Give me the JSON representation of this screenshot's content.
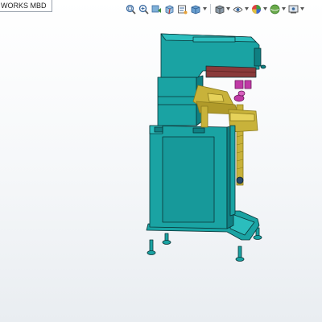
{
  "document": {
    "tab_label": "WORKS MBD"
  },
  "toolbar": {
    "buttons": [
      {
        "name": "zoom-to-fit-icon",
        "dropdown": false
      },
      {
        "name": "zoom-to-area-icon",
        "dropdown": false
      },
      {
        "name": "previous-view-icon",
        "dropdown": false
      },
      {
        "name": "section-view-icon",
        "dropdown": false
      },
      {
        "name": "dynamic-annotation-icon",
        "dropdown": false
      },
      {
        "name": "view-orientation-icon",
        "dropdown": true
      },
      {
        "name": "display-style-icon",
        "dropdown": true
      },
      {
        "name": "hide-show-items-icon",
        "dropdown": true
      },
      {
        "name": "edit-appearance-icon",
        "dropdown": true
      },
      {
        "name": "apply-scene-icon",
        "dropdown": true
      },
      {
        "name": "view-settings-icon",
        "dropdown": true
      }
    ]
  },
  "colors": {
    "body_teal": "#1aa3a3",
    "body_teal_dark": "#0f7f82",
    "outline": "#0a3436",
    "brass": "#c8b23a",
    "brass_dark": "#8a7a1c",
    "magenta": "#c03aa6",
    "maroon": "#8a3a3a"
  }
}
